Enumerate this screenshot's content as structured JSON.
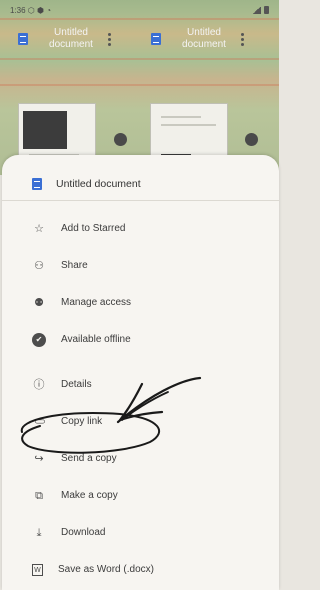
{
  "statusbar": {
    "time": "1:36 ⬡ ⬢ ◔",
    "right": "▲◢"
  },
  "background": {
    "cards": [
      {
        "title": "Untitled document"
      },
      {
        "title": "Untitled document"
      }
    ]
  },
  "sheet": {
    "header_title": "Untitled document",
    "items": [
      {
        "label": "Add to Starred",
        "icon": "star-outline-icon",
        "glyph": "☆"
      },
      {
        "label": "Share",
        "icon": "person-add-icon",
        "glyph": "⚇"
      },
      {
        "label": "Manage access",
        "icon": "people-icon",
        "glyph": "⚉"
      },
      {
        "label": "Available offline",
        "icon": "offline-check-icon",
        "glyph": "✔"
      },
      {
        "label": "Details",
        "icon": "info-icon",
        "glyph": "ⓘ"
      },
      {
        "label": "Copy link",
        "icon": "link-icon",
        "glyph": "⊂⊃"
      },
      {
        "label": "Send a copy",
        "icon": "send-arrow-icon",
        "glyph": "↪"
      },
      {
        "label": "Make a copy",
        "icon": "copy-icon",
        "glyph": "⧉"
      },
      {
        "label": "Download",
        "icon": "download-icon",
        "glyph": "⤓"
      },
      {
        "label": "Save as Word (.docx)",
        "icon": "word-doc-icon",
        "glyph": "W"
      }
    ]
  },
  "colors": {
    "doc_blue": "#3b6fd4",
    "sheet_bg": "#f7f5f1",
    "ink": "#1a1a1a"
  }
}
